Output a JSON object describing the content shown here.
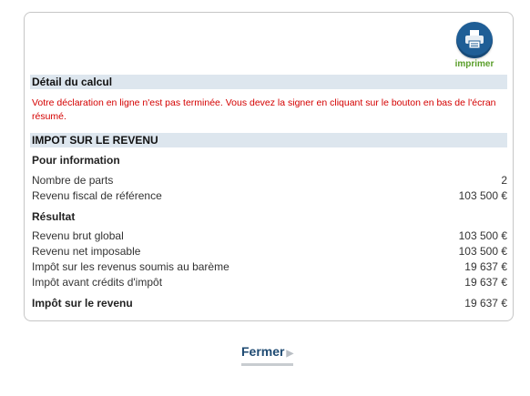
{
  "print": {
    "label": "imprimer"
  },
  "detail": {
    "title": "Détail du calcul",
    "warning": "Votre déclaration en ligne n'est pas terminée. Vous devez la signer en cliquant sur le bouton en bas de l'écran résumé."
  },
  "impot": {
    "title": "IMPOT SUR LE REVENU",
    "info_heading": "Pour information",
    "info_rows": [
      {
        "label": "Nombre de parts",
        "value": "2"
      },
      {
        "label": "Revenu fiscal de référence",
        "value": "103 500 €"
      }
    ],
    "result_heading": "Résultat",
    "result_rows": [
      {
        "label": "Revenu brut global",
        "value": "103 500 €"
      },
      {
        "label": "Revenu net imposable",
        "value": "103 500 €"
      },
      {
        "label": "Impôt sur les revenus soumis au barème",
        "value": "19 637 €"
      },
      {
        "label": "Impôt avant crédits d'impôt",
        "value": "19 637 €"
      }
    ],
    "total": {
      "label": "Impôt sur le revenu",
      "value": "19 637 €"
    }
  },
  "footer": {
    "close_label": "Fermer"
  },
  "colors": {
    "accent": "#1e4a72",
    "warning": "#d40000",
    "print_label": "#5a9e2a",
    "section_bar": "#dde6ee"
  }
}
